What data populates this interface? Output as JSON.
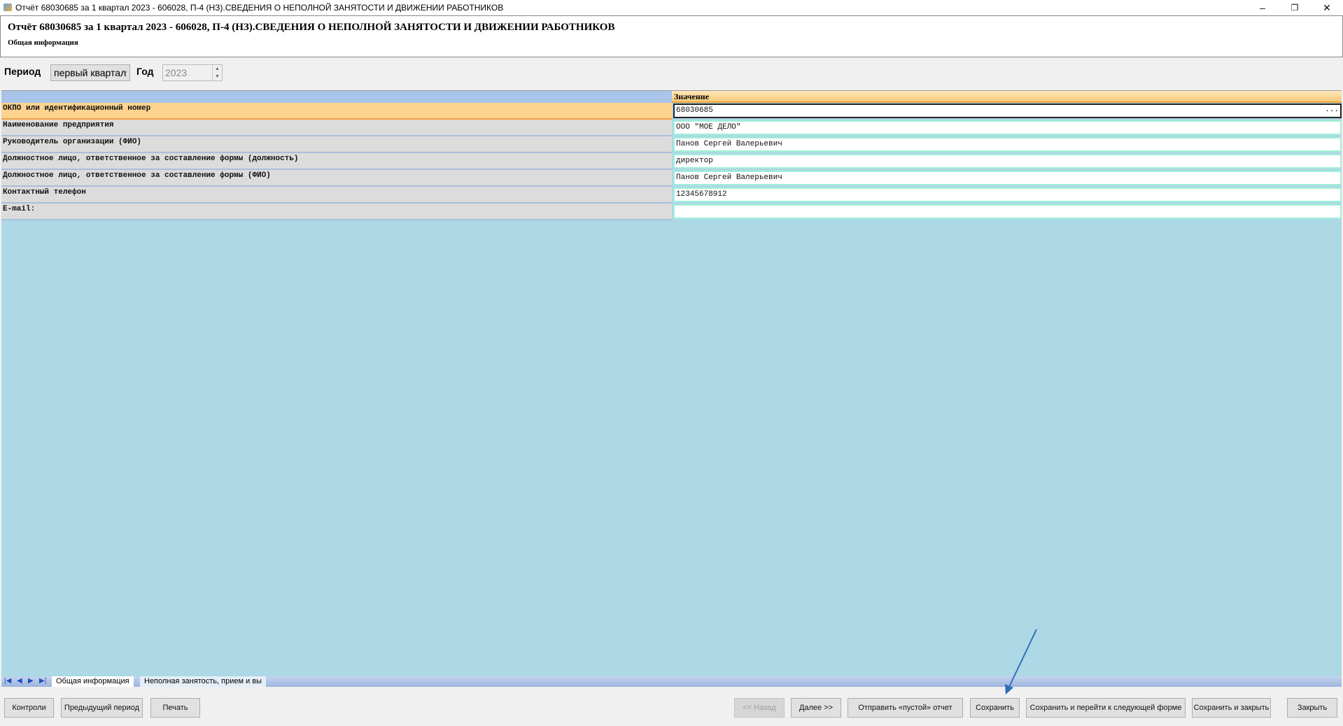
{
  "window": {
    "title": "Отчёт 68030685 за 1 квартал 2023 - 606028, П-4 (НЗ).СВЕДЕНИЯ О НЕПОЛНОЙ ЗАНЯТОСТИ И ДВИЖЕНИИ РАБОТНИКОВ",
    "minimize": "–",
    "restore": "❐",
    "close": "✕"
  },
  "header": {
    "title": "Отчёт 68030685 за 1 квартал 2023 - 606028, П-4 (НЗ).СВЕДЕНИЯ О НЕПОЛНОЙ ЗАНЯТОСТИ И ДВИЖЕНИИ РАБОТНИКОВ",
    "subtitle": "Общая информация"
  },
  "filters": {
    "period_label": "Период",
    "period_value": "первый квартал",
    "year_label": "Год",
    "year_value": "2023"
  },
  "grid": {
    "value_header": "Значение",
    "rows": [
      {
        "label": "ОКПО или идентификационный номер",
        "value": "68030685"
      },
      {
        "label": "Наименование предприятия",
        "value": "ООО  \"МОЕ ДЕЛО\""
      },
      {
        "label": "Руководитель организации (ФИО)",
        "value": "Панов Сергей Валерьевич"
      },
      {
        "label": "Должностное лицо, ответственное за составление формы (должность)",
        "value": "директор"
      },
      {
        "label": "Должностное лицо, ответственное за составление формы (ФИО)",
        "value": "Панов Сергей Валерьевич"
      },
      {
        "label": "Контактный телефон",
        "value": "12345678912"
      },
      {
        "label": "E-mail:",
        "value": ""
      }
    ],
    "ellipsis": "..."
  },
  "tabs": [
    "Общая информация",
    "Неполная занятость, прием и вы"
  ],
  "buttons": {
    "controls": "Контроли",
    "prev_period": "Предыдущий период",
    "print": "Печать",
    "back": "<< Назад",
    "next": "Далее >>",
    "send_empty": "Отправить «пустой» отчет",
    "save": "Сохранить",
    "save_next": "Сохранить и перейти к следующей форме",
    "save_close": "Сохранить и закрыть",
    "close": "Закрыть"
  }
}
